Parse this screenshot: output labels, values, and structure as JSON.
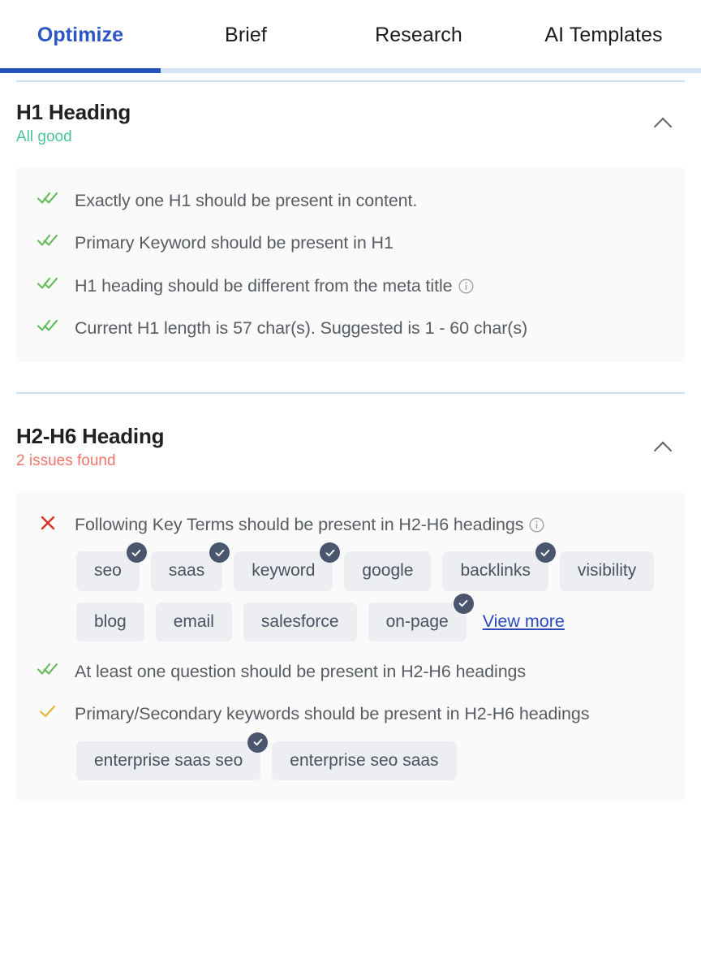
{
  "tabs": [
    {
      "label": "Optimize",
      "active": true
    },
    {
      "label": "Brief",
      "active": false
    },
    {
      "label": "Research",
      "active": false
    },
    {
      "label": "AI Templates",
      "active": false
    }
  ],
  "colors": {
    "accent_blue": "#2b56c4",
    "underline_active": "#2550ba",
    "underline_track": "#d6e4f7",
    "status_good": "#4cc49a",
    "status_issue": "#f4766a",
    "check_green": "#63bb5b",
    "check_amber": "#e8b23a",
    "cross_red": "#d93025",
    "chip_bg": "#eceef2",
    "chip_badge": "#4a566e",
    "link_blue": "#2b49bd",
    "panel_bg": "#fafafb",
    "divider": "#cfe0f3"
  },
  "sections": [
    {
      "title": "H1 Heading",
      "status": "All good",
      "status_type": "good",
      "collapse_icon": "chevron-up-icon",
      "items": [
        {
          "icon": "double-check-green-icon",
          "text": "Exactly one H1 should be present in content.",
          "info": false
        },
        {
          "icon": "double-check-green-icon",
          "text": "Primary Keyword should be present in H1",
          "info": false
        },
        {
          "icon": "double-check-green-icon",
          "text": "H1 heading should be different from the meta title",
          "info": true
        },
        {
          "icon": "double-check-green-icon",
          "text": "Current H1 length is 57 char(s). Suggested is 1 - 60 char(s)",
          "info": false
        }
      ]
    },
    {
      "title": "H2-H6 Heading",
      "status": "2 issues found",
      "status_type": "issue",
      "collapse_icon": "chevron-up-icon",
      "items": [
        {
          "icon": "cross-red-icon",
          "text": "Following Key Terms should be present in H2-H6 headings",
          "info": true,
          "chips": [
            {
              "label": "seo",
              "checked": true
            },
            {
              "label": "saas",
              "checked": true
            },
            {
              "label": "keyword",
              "checked": true
            },
            {
              "label": "google",
              "checked": false
            },
            {
              "label": "backlinks",
              "checked": true
            },
            {
              "label": "visibility",
              "checked": false
            },
            {
              "label": "blog",
              "checked": false
            },
            {
              "label": "email",
              "checked": false
            },
            {
              "label": "salesforce",
              "checked": false
            },
            {
              "label": "on-page",
              "checked": true
            }
          ],
          "view_more": "View more"
        },
        {
          "icon": "double-check-green-icon",
          "text": "At least one question should be present in H2-H6 headings",
          "info": false
        },
        {
          "icon": "single-check-amber-icon",
          "text": "Primary/Secondary keywords should be present in H2-H6 headings",
          "info": false,
          "chips": [
            {
              "label": "enterprise saas seo",
              "checked": true
            },
            {
              "label": "enterprise seo saas",
              "checked": false
            }
          ]
        }
      ]
    }
  ]
}
